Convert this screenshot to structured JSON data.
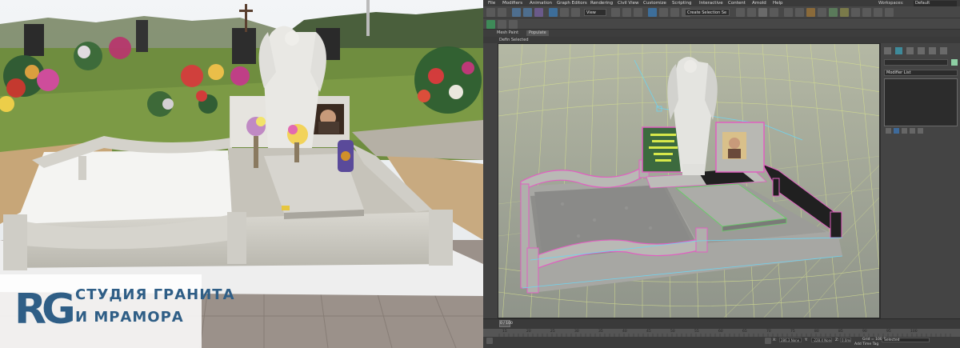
{
  "logo": {
    "mark": "RG",
    "line1": "СТУДИЯ ГРАНИТА",
    "line2": "И МРАМОРА",
    "color": "#2f5e86"
  },
  "app": {
    "menu": [
      "File",
      "Modifiers",
      "Animation",
      "Graph Editors",
      "Rendering",
      "Civil View",
      "Customize",
      "Scripting",
      "Interactive",
      "Content",
      "Arnold",
      "Help"
    ],
    "workspaces_label": "Workspaces:",
    "workspace_value": "Default",
    "toolbar": {
      "view_combo": "View",
      "selection_set_combo": "Create Selection Se"
    },
    "ribbon_tabs": [
      "Mesh Paint",
      "Populate"
    ],
    "defn_label": "Defin Selected",
    "command_panel": {
      "modifier_list": "Modifier List"
    },
    "timeline": {
      "slider": "0 / 100",
      "ticks": [
        "15",
        "20",
        "25",
        "30",
        "35",
        "40",
        "45",
        "50",
        "55",
        "60",
        "65",
        "70",
        "75",
        "80",
        "85",
        "90",
        "95",
        "100"
      ]
    },
    "status": {
      "x_label": "X:",
      "x_value": "286.3 None",
      "y_label": "Y:",
      "y_value": "-228.4 None",
      "z_label": "Z:",
      "z_value": "0.0mm",
      "grid": "Grid = 100.0m",
      "selected": "Selected",
      "add_time_tag": "Add Time Tag"
    },
    "colors": {
      "selection_green": "#8ecfa4",
      "highlight_pink": "#e060c0",
      "wire_cyan": "#6fd4f0"
    }
  }
}
